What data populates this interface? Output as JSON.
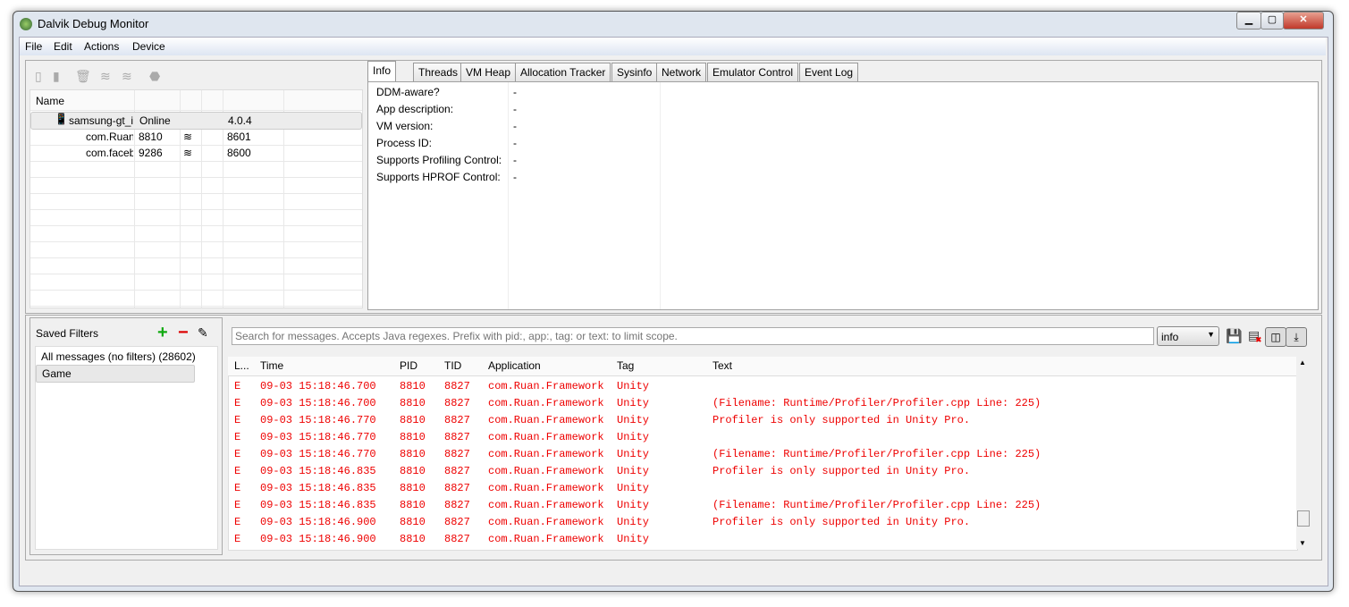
{
  "window": {
    "title": "Dalvik Debug Monitor"
  },
  "menu": [
    "File",
    "Edit",
    "Actions",
    "Device"
  ],
  "device_toolbar": {
    "icons": [
      "debug-icon",
      "update-heap-icon",
      "gc-icon",
      "update-threads-icon",
      "start-method-profiling-icon",
      "stop-icon"
    ]
  },
  "devices": {
    "header": "Name",
    "rows": [
      {
        "name": "samsung-gt_i",
        "status": "Online",
        "col3": "",
        "col4": "4.0.4",
        "icon": "phone-icon"
      },
      {
        "name": "com.Ruan",
        "status": "8810",
        "col3": "bug",
        "col4": "8601"
      },
      {
        "name": "com.faceb",
        "status": "9286",
        "col3": "bug",
        "col4": "8600"
      }
    ]
  },
  "tabs": [
    "Info",
    "Threads",
    "VM Heap",
    "Allocation Tracker",
    "Sysinfo",
    "Network",
    "Emulator Control",
    "Event Log"
  ],
  "info": [
    {
      "label": "DDM-aware?",
      "value": "-"
    },
    {
      "label": "App description:",
      "value": "-"
    },
    {
      "label": "VM version:",
      "value": "-"
    },
    {
      "label": "Process ID:",
      "value": "-"
    },
    {
      "label": "Supports Profiling Control:",
      "value": "-"
    },
    {
      "label": "Supports HPROF Control:",
      "value": "-"
    }
  ],
  "filters": {
    "title": "Saved Filters",
    "items": [
      "All messages (no filters) (28602)",
      "Game"
    ]
  },
  "logcat": {
    "search_placeholder": "Search for messages. Accepts Java regexes. Prefix with pid:, app:, tag: or text: to limit scope.",
    "level": "info",
    "columns": [
      "L...",
      "Time",
      "PID",
      "TID",
      "Application",
      "Tag",
      "Text"
    ],
    "accent": "#ee0000",
    "rows": [
      {
        "l": "E",
        "time": "09-03 15:18:46.700",
        "pid": "8810",
        "tid": "8827",
        "app": "com.Ruan.Framework",
        "tag": "Unity",
        "text": ""
      },
      {
        "l": "E",
        "time": "09-03 15:18:46.700",
        "pid": "8810",
        "tid": "8827",
        "app": "com.Ruan.Framework",
        "tag": "Unity",
        "text": "(Filename: Runtime/Profiler/Profiler.cpp Line: 225)"
      },
      {
        "l": "E",
        "time": "09-03 15:18:46.770",
        "pid": "8810",
        "tid": "8827",
        "app": "com.Ruan.Framework",
        "tag": "Unity",
        "text": "Profiler is only supported in Unity Pro."
      },
      {
        "l": "E",
        "time": "09-03 15:18:46.770",
        "pid": "8810",
        "tid": "8827",
        "app": "com.Ruan.Framework",
        "tag": "Unity",
        "text": ""
      },
      {
        "l": "E",
        "time": "09-03 15:18:46.770",
        "pid": "8810",
        "tid": "8827",
        "app": "com.Ruan.Framework",
        "tag": "Unity",
        "text": "(Filename: Runtime/Profiler/Profiler.cpp Line: 225)"
      },
      {
        "l": "E",
        "time": "09-03 15:18:46.835",
        "pid": "8810",
        "tid": "8827",
        "app": "com.Ruan.Framework",
        "tag": "Unity",
        "text": "Profiler is only supported in Unity Pro."
      },
      {
        "l": "E",
        "time": "09-03 15:18:46.835",
        "pid": "8810",
        "tid": "8827",
        "app": "com.Ruan.Framework",
        "tag": "Unity",
        "text": ""
      },
      {
        "l": "E",
        "time": "09-03 15:18:46.835",
        "pid": "8810",
        "tid": "8827",
        "app": "com.Ruan.Framework",
        "tag": "Unity",
        "text": "(Filename: Runtime/Profiler/Profiler.cpp Line: 225)"
      },
      {
        "l": "E",
        "time": "09-03 15:18:46.900",
        "pid": "8810",
        "tid": "8827",
        "app": "com.Ruan.Framework",
        "tag": "Unity",
        "text": "Profiler is only supported in Unity Pro."
      },
      {
        "l": "E",
        "time": "09-03 15:18:46.900",
        "pid": "8810",
        "tid": "8827",
        "app": "com.Ruan.Framework",
        "tag": "Unity",
        "text": ""
      }
    ]
  }
}
